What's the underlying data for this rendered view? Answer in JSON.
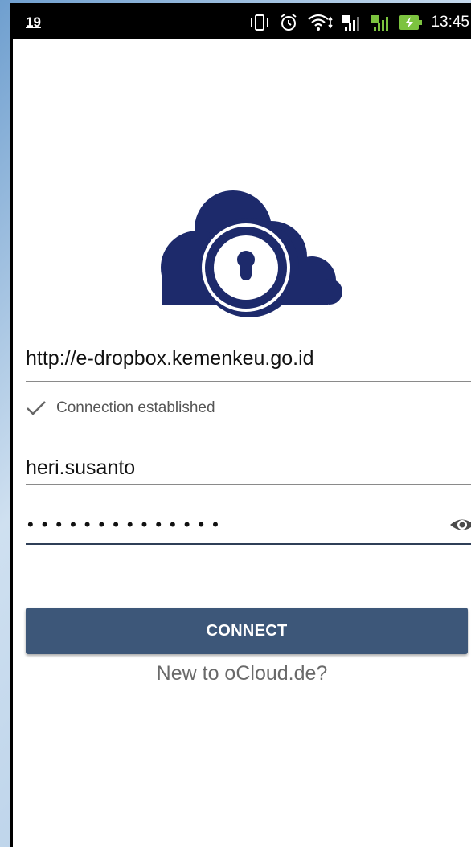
{
  "status_bar": {
    "left_text": "19",
    "time": "13:45",
    "icons": [
      "vibrate-icon",
      "alarm-icon",
      "wifi-icon",
      "signal-sim1-icon",
      "signal-sim2-icon",
      "battery-charging-icon"
    ]
  },
  "colors": {
    "brand_navy": "#1d2a6b",
    "button": "#3d5779",
    "underline_active": "#2f3f57"
  },
  "login": {
    "server_url": "http://e-dropbox.kemenkeu.go.id",
    "connection_status": "Connection established",
    "username": "heri.susanto",
    "password_mask": "••••••••••••••",
    "connect_label": "CONNECT",
    "new_account_link": "New to oCloud.de?"
  }
}
